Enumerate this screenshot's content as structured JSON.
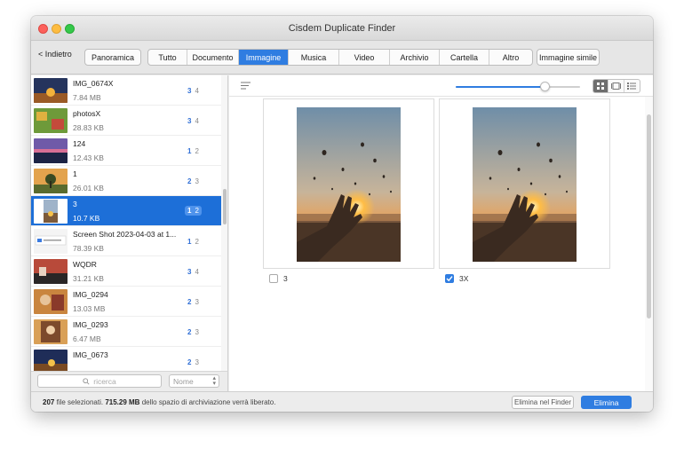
{
  "window": {
    "title": "Cisdem Duplicate Finder"
  },
  "toolbar": {
    "back_label": "< Indietro",
    "overview_label": "Panoramica",
    "tabs": [
      "Tutto",
      "Documento",
      "Immagine",
      "Musica",
      "Video",
      "Archivio",
      "Cartella",
      "Altro"
    ],
    "active_tab": "Immagine",
    "similar_label": "Immagine simile"
  },
  "sidebar": {
    "items": [
      {
        "name": "IMG_0674X",
        "size": "7.84 MB",
        "dup": "3",
        "total": "4"
      },
      {
        "name": "photosX",
        "size": "28.83 KB",
        "dup": "3",
        "total": "4"
      },
      {
        "name": "124",
        "size": "12.43 KB",
        "dup": "1",
        "total": "2"
      },
      {
        "name": "1",
        "size": "26.01 KB",
        "dup": "2",
        "total": "3"
      },
      {
        "name": "3",
        "size": "10.7 KB",
        "dup": "1",
        "total": "2"
      },
      {
        "name": "Screen Shot 2023-04-03 at 1...",
        "size": "78.39 KB",
        "dup": "1",
        "total": "2"
      },
      {
        "name": "WQDR",
        "size": "31.21 KB",
        "dup": "3",
        "total": "4"
      },
      {
        "name": "IMG_0294",
        "size": "13.03 MB",
        "dup": "2",
        "total": "3"
      },
      {
        "name": "IMG_0293",
        "size": "6.47 MB",
        "dup": "2",
        "total": "3"
      },
      {
        "name": "IMG_0673",
        "size": "",
        "dup": "2",
        "total": "3"
      }
    ],
    "selected_index": 4,
    "search_placeholder": "ricerca",
    "sort_value": "Nome"
  },
  "main": {
    "zoom_level": 0.72,
    "view_modes": [
      "grid-view-icon",
      "single-view-icon",
      "list-view-icon"
    ],
    "cards": [
      {
        "caption": "3",
        "checked": false
      },
      {
        "caption": "3X",
        "checked": true
      }
    ]
  },
  "footer": {
    "count": "207",
    "count_label": "file selezionati.",
    "space": "715.29 MB",
    "space_label": "dello spazio di archiviazione verrà liberato.",
    "finder_label": "Elimina nel Finder",
    "delete_label": "Elimina"
  },
  "colors": {
    "accent": "#2f7de1",
    "selection": "#1d6fd8",
    "duplicate_count": "#2f6fd6"
  }
}
